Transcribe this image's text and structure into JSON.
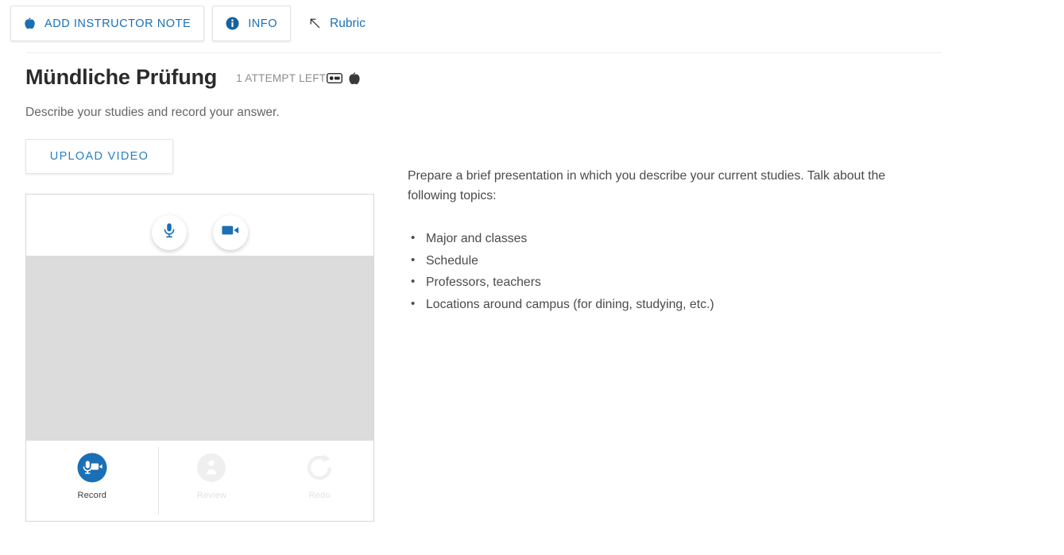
{
  "toolbar": {
    "buttons": [
      {
        "label": "ADD INSTRUCTOR NOTE",
        "icon": "apple-icon",
        "style": "boxed"
      },
      {
        "label": "INFO",
        "icon": "info-circle-icon",
        "style": "boxed"
      },
      {
        "label": "Rubric",
        "icon": "arrow-up-left-icon",
        "style": "plain"
      }
    ]
  },
  "header": {
    "title": "Mündliche Prüfung",
    "attempts": "1 ATTEMPT LEFT",
    "attempt_badge_icon": "recording-badge-icon",
    "apple_badge_icon": "apple-icon",
    "subtitle": "Describe your studies and record your answer."
  },
  "upload": {
    "label": "UPLOAD VIDEO"
  },
  "recorder": {
    "mic_icon": "microphone-icon",
    "camera_icon": "video-camera-icon",
    "stage_color": "#dcdcdc",
    "controls": [
      {
        "label": "Record",
        "icon": "record-mic-camera-icon",
        "state": "enabled"
      },
      {
        "label": "Review",
        "icon": "review-play-icon",
        "state": "disabled"
      },
      {
        "label": "Redo",
        "icon": "redo-circular-arrow-icon",
        "state": "disabled"
      }
    ]
  },
  "prompt": {
    "intro": "Prepare a brief presentation in which you describe your current studies. Talk about the following topics:",
    "topics": [
      "Major and classes",
      "Schedule",
      "Professors, teachers",
      "Locations around campus (for dining, studying, etc.)"
    ]
  },
  "colors": {
    "accent_blue": "#1b6fb5",
    "link_blue": "#2a7fc0",
    "stage_grey": "#dcdcdc",
    "disabled_grey": "#ededed"
  }
}
